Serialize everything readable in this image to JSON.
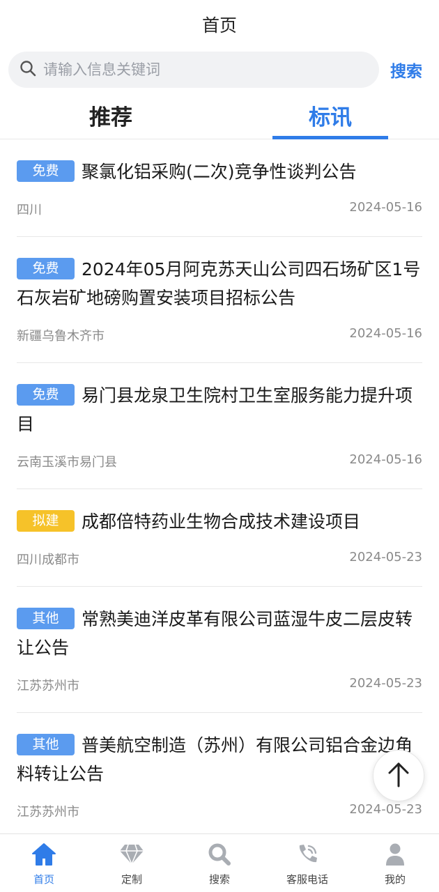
{
  "header": {
    "title": "首页"
  },
  "search": {
    "placeholder": "请输入信息关键词",
    "button_label": "搜索"
  },
  "tabs": [
    {
      "label": "推荐",
      "active": false
    },
    {
      "label": "标讯",
      "active": true
    }
  ],
  "items": [
    {
      "badge": "免费",
      "badge_color": "#5b9bef",
      "title": "聚氯化铝采购(二次)竞争性谈判公告",
      "region": "四川",
      "date": "2024-05-16"
    },
    {
      "badge": "免费",
      "badge_color": "#5b9bef",
      "title": "2024年05月阿克苏天山公司四石场矿区1号石灰岩矿地磅购置安装项目招标公告",
      "region": "新疆乌鲁木齐市",
      "date": "2024-05-16"
    },
    {
      "badge": "免费",
      "badge_color": "#5b9bef",
      "title": "易门县龙泉卫生院村卫生室服务能力提升项目",
      "region": "云南玉溪市易门县",
      "date": "2024-05-16"
    },
    {
      "badge": "拟建",
      "badge_color": "#f6c229",
      "title": "成都倍特药业生物合成技术建设项目",
      "region": "四川成都市",
      "date": "2024-05-23"
    },
    {
      "badge": "其他",
      "badge_color": "#5b9bef",
      "title": "常熟美迪洋皮革有限公司蓝湿牛皮二层皮转让公告",
      "region": "江苏苏州市",
      "date": "2024-05-23"
    },
    {
      "badge": "其他",
      "badge_color": "#5b9bef",
      "title": "普美航空制造（苏州）有限公司铝合金边角料转让公告",
      "region": "江苏苏州市",
      "date": "2024-05-23"
    }
  ],
  "back_to_top": {
    "icon": "arrow-up-icon"
  },
  "tabbar": [
    {
      "label": "首页",
      "icon": "home-icon",
      "active": true
    },
    {
      "label": "定制",
      "icon": "diamond-icon",
      "active": false
    },
    {
      "label": "搜索",
      "icon": "search-icon",
      "active": false
    },
    {
      "label": "客服电话",
      "icon": "phone-icon",
      "active": false
    },
    {
      "label": "我的",
      "icon": "user-icon",
      "active": false
    }
  ],
  "colors": {
    "accent": "#2f7ce8",
    "badge_blue": "#5b9bef",
    "badge_yellow": "#f6c229",
    "tabbar_inactive": "#a9adb3"
  }
}
